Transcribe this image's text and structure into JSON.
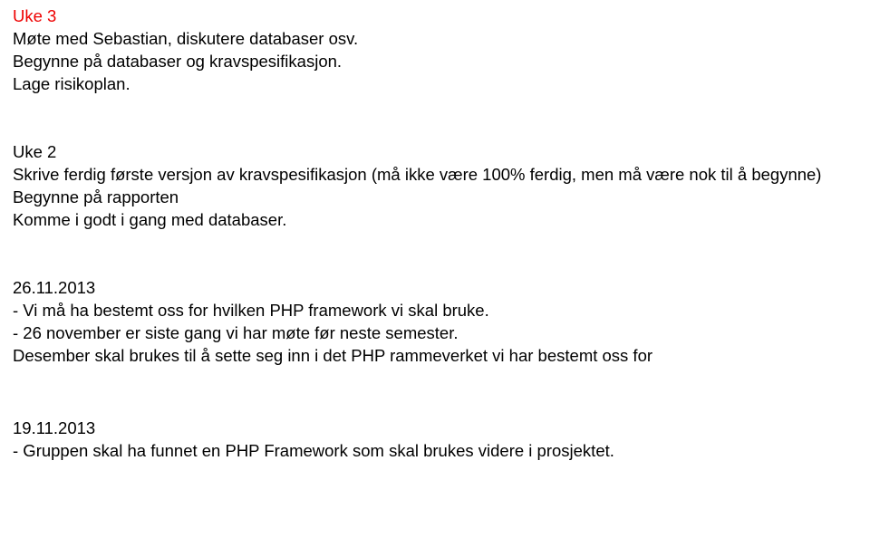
{
  "week3": {
    "title": "Uke 3",
    "line1": "Møte med Sebastian, diskutere databaser osv.",
    "line2": "Begynne på databaser og kravspesifikasjon.",
    "line3": "Lage risikoplan."
  },
  "week2": {
    "title": "Uke 2",
    "line1": "Skrive ferdig første versjon av kravspesifikasjon (må ikke være 100% ferdig, men må være nok til å begynne)",
    "line2": "Begynne på rapporten",
    "line3": "Komme i godt i gang med databaser."
  },
  "entry1": {
    "date": "26.11.2013",
    "line1": "- Vi må ha bestemt oss for hvilken PHP framework vi skal bruke.",
    "line2": "- 26 november er siste gang vi har møte før neste semester.",
    "line3": "Desember skal brukes til å sette seg inn i det PHP rammeverket vi har bestemt oss for"
  },
  "entry2": {
    "date": "19.11.2013",
    "line1": "- Gruppen skal ha funnet en PHP Framework som skal brukes videre i prosjektet."
  }
}
